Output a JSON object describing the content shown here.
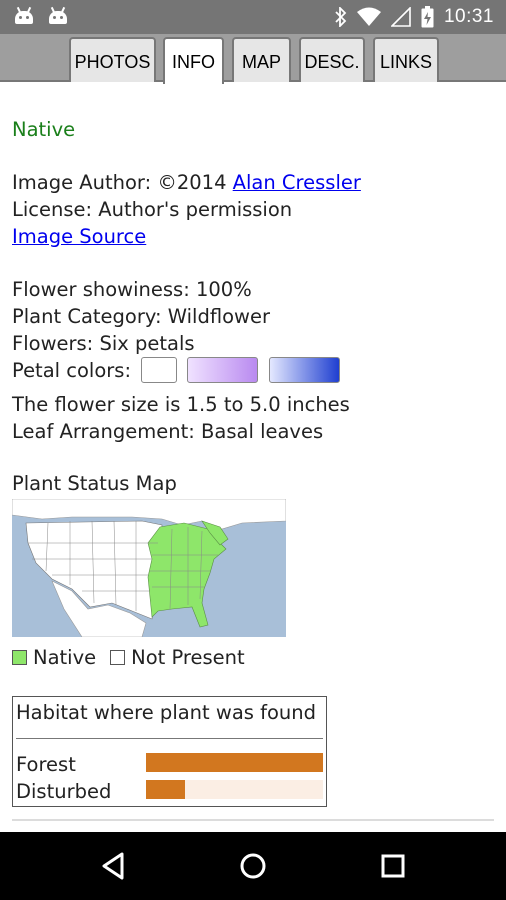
{
  "status_bar": {
    "time": "10:31",
    "icons": [
      "android-icon",
      "android-icon",
      "bluetooth-icon",
      "wifi-icon",
      "signal-icon",
      "battery-icon"
    ]
  },
  "tabs": [
    {
      "label": "PHOTOS",
      "active": false
    },
    {
      "label": "INFO",
      "active": true
    },
    {
      "label": "MAP",
      "active": false
    },
    {
      "label": "DESC.",
      "active": false
    },
    {
      "label": "LINKS",
      "active": false
    }
  ],
  "info": {
    "status": "Native",
    "image_author_prefix": "Image Author: ©2014 ",
    "image_author_name": "Alan Cressler",
    "license": "License: Author's permission",
    "image_source_link": "Image Source",
    "flower_showiness": "Flower showiness: 100%",
    "plant_category": "Plant Category: Wildflower",
    "flowers": "Flowers: Six petals",
    "petal_colors_label": "Petal colors:",
    "petal_colors": [
      "#ffffff",
      "#c9a0f2",
      "#2a49d6"
    ],
    "flower_size": "The flower size is 1.5 to 5.0 inches",
    "leaf_arrangement": "Leaf Arrangement: Basal leaves"
  },
  "status_map": {
    "title": "Plant Status Map",
    "water_color": "#a8bfd8",
    "native_color": "#8ee66a",
    "not_present_color": "#ffffff",
    "legend": [
      {
        "label": "Native",
        "color": "#8ee66a"
      },
      {
        "label": "Not Present",
        "color": "#ffffff"
      }
    ]
  },
  "habitat": {
    "title": "Habitat where plant was found",
    "rows": [
      {
        "label": "Forest",
        "fraction": 1.0
      },
      {
        "label": "Disturbed",
        "fraction": 0.22
      }
    ],
    "bar_color": "#d2771f"
  },
  "nav": {
    "buttons": [
      "back-icon",
      "home-icon",
      "recents-icon"
    ]
  }
}
